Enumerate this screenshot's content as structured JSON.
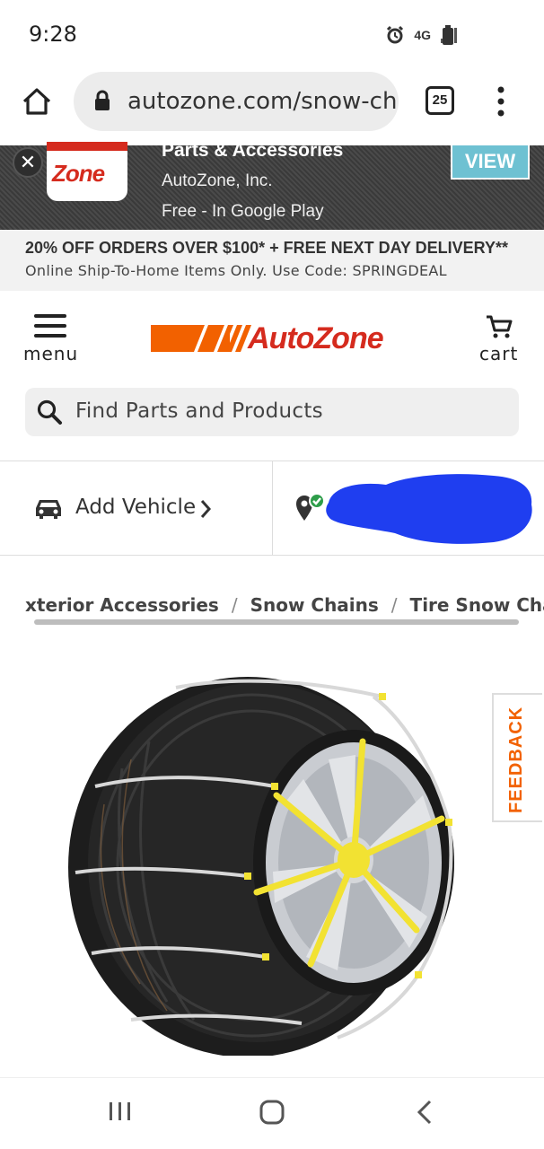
{
  "status_bar": {
    "time": "9:28",
    "network": "4G"
  },
  "browser": {
    "url": "autozone.com/snow-cha",
    "tab_count": "25"
  },
  "app_banner": {
    "logo_text": "Zone",
    "title": "Parts & Accessories",
    "publisher": "AutoZone, Inc.",
    "subtitle": "Free - In Google Play",
    "view_label": "VIEW"
  },
  "promo": {
    "headline": "20% OFF ORDERS OVER $100* + FREE NEXT DAY DELIVERY**",
    "detail": "Online Ship-To-Home Items Only. Use Code: SPRINGDEAL"
  },
  "header": {
    "menu_label": "menu",
    "cart_label": "cart",
    "logo_text": "AutoZone"
  },
  "search": {
    "placeholder": "Find Parts and Products"
  },
  "vehicle": {
    "add_label": "Add Vehicle"
  },
  "breadcrumbs": [
    "xterior Accessories",
    "Snow Chains",
    "Tire Snow Chain"
  ],
  "feedback_label": "FEEDBACK",
  "colors": {
    "brand_orange": "#f26100",
    "brand_red": "#d52b1e",
    "view_button": "#6ec1d2",
    "redaction_blue": "#1f3ef0"
  },
  "icons": [
    "home-icon",
    "lock-icon",
    "tabs-icon",
    "kebab-icon",
    "close-icon",
    "hamburger-icon",
    "cart-icon",
    "search-icon",
    "car-icon",
    "chevron-right-icon",
    "location-pin-icon",
    "recents-icon",
    "home-nav-icon",
    "back-icon"
  ]
}
